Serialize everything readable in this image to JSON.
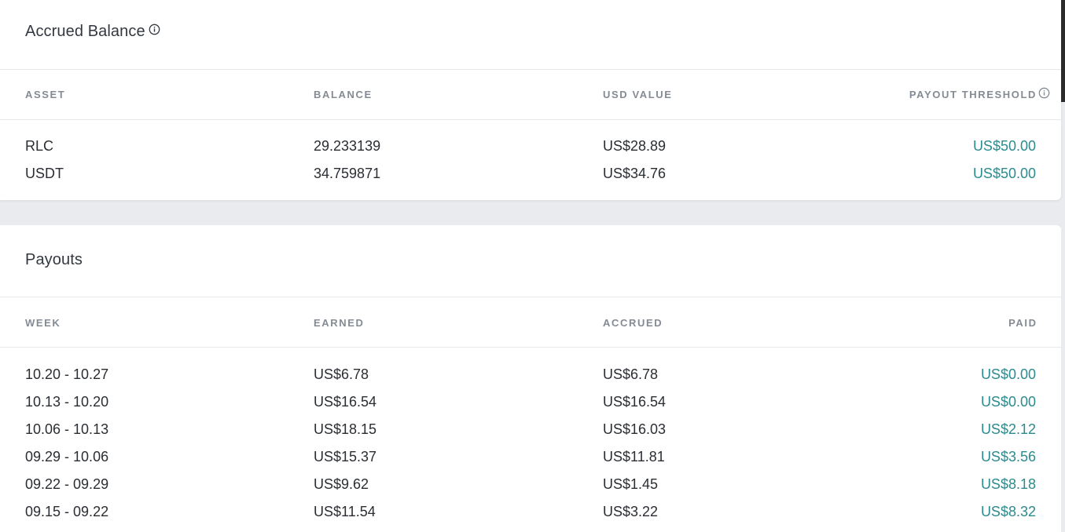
{
  "colors": {
    "accent": "#2b8b8e",
    "text": "#2a2e33",
    "muted": "#858b94",
    "background": "#e9ebef"
  },
  "accrued_balance": {
    "title": "Accrued Balance",
    "columns": [
      "ASSET",
      "BALANCE",
      "USD VALUE",
      "PAYOUT THRESHOLD"
    ],
    "rows": [
      {
        "asset": "RLC",
        "balance": "29.233139",
        "usd_value": "US$28.89",
        "payout_threshold": "US$50.00"
      },
      {
        "asset": "USDT",
        "balance": "34.759871",
        "usd_value": "US$34.76",
        "payout_threshold": "US$50.00"
      }
    ]
  },
  "payouts": {
    "title": "Payouts",
    "columns": [
      "WEEK",
      "EARNED",
      "ACCRUED",
      "PAID"
    ],
    "rows": [
      {
        "week": "10.20 - 10.27",
        "earned": "US$6.78",
        "accrued": "US$6.78",
        "paid": "US$0.00"
      },
      {
        "week": "10.13 - 10.20",
        "earned": "US$16.54",
        "accrued": "US$16.54",
        "paid": "US$0.00"
      },
      {
        "week": "10.06 - 10.13",
        "earned": "US$18.15",
        "accrued": "US$16.03",
        "paid": "US$2.12"
      },
      {
        "week": "09.29 - 10.06",
        "earned": "US$15.37",
        "accrued": "US$11.81",
        "paid": "US$3.56"
      },
      {
        "week": "09.22 - 09.29",
        "earned": "US$9.62",
        "accrued": "US$1.45",
        "paid": "US$8.18"
      },
      {
        "week": "09.15 - 09.22",
        "earned": "US$11.54",
        "accrued": "US$3.22",
        "paid": "US$8.32"
      }
    ]
  }
}
